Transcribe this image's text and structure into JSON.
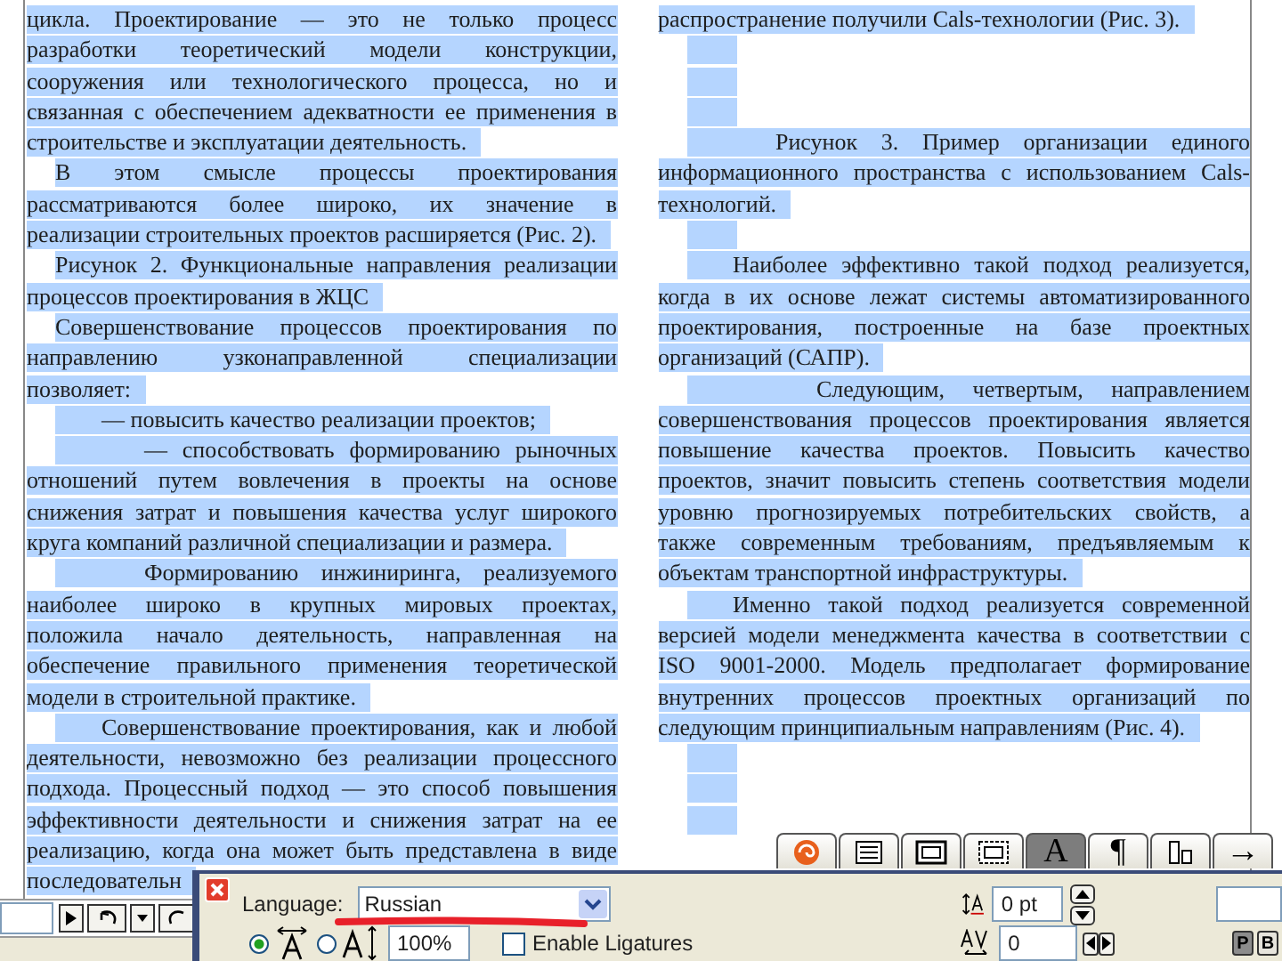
{
  "document": {
    "text_selected": true,
    "columns": [
      {
        "paragraphs": [
          {
            "kind": "continued",
            "lines": [
              "цикла. Проектирование — это не только процесс",
              "разработки теоретический модели конструкции,",
              "сооружения или технологического процесса, но и",
              "связанная с обеспечением адекватности ее применения в",
              "строительстве и эксплуатации деятельность."
            ]
          },
          {
            "kind": "tab1",
            "lines": [
              "В этом смысле процессы проектирования",
              "рассматриваются более широко, их значение в",
              "реализации строительных проектов расширяется (Рис. 2)."
            ]
          },
          {
            "kind": "tab1",
            "lines": [
              "Рисунок 2. Функциональные направления реализации",
              "процессов проектирования в ЖЦС"
            ]
          },
          {
            "kind": "tab1",
            "lines": [
              "Совершенствование процессов проектирования по",
              "направлению узконаправленной специализации",
              "позволяет:"
            ]
          },
          {
            "kind": "tab2",
            "lines": [
              "— повысить качество реализации проектов;"
            ]
          },
          {
            "kind": "tab3",
            "lines": [
              "— способствовать формированию рыночных",
              "отношений путем вовлечения в проекты  на основе",
              "снижения затрат и повышения качества услуг широкого",
              "круга компаний различной специализации и размера."
            ]
          },
          {
            "kind": "tab3",
            "lines": [
              "Формированию инжиниринга, реализуемого",
              "наиболее широко в крупных мировых проектах,",
              "положила начало деятельность, направленная на",
              "обеспечение правильного применения теоретической",
              "модели  в строительной практике."
            ]
          },
          {
            "kind": "tab2",
            "lines": [
              "Совершенствование проектирования, как и любой",
              "деятельности, невозможно без реализации процессного",
              "подхода. Процессный подход — это способ повышения",
              "эффективности деятельности и снижения затрат на ее",
              "реализацию, когда она может быть представлена в виде",
              "последовательн"
            ]
          }
        ]
      },
      {
        "paragraphs": [
          {
            "kind": "continued",
            "lines": [
              "распространение получили Cals-технологии (Рис. 3)."
            ]
          },
          {
            "kind": "empty"
          },
          {
            "kind": "empty"
          },
          {
            "kind": "empty"
          },
          {
            "kind": "tab3",
            "lines": [
              "Рисунок 3. Пример организации единого",
              "информационного пространства с использованием Cals-",
              "технологий."
            ]
          },
          {
            "kind": "empty"
          },
          {
            "kind": "tab2",
            "lines": [
              "Наиболее эффективно такой подход реализуется,",
              "когда в их основе лежат системы автоматизированного",
              "проектирования, построенные на базе проектных",
              "организаций (САПР)."
            ]
          },
          {
            "kind": "tab4",
            "lines": [
              "Следующим, четвертым, направлением",
              "совершенствования процессов проектирования является",
              "повышение качества проектов. Повысить качество",
              "проектов, значит повысить степень соответствия модели",
              "уровню прогнозируемых потребительских свойств, а",
              "также современным требованиям, предъявляемым к",
              "объектам транспортной инфраструктуры."
            ]
          },
          {
            "kind": "tab2",
            "lines": [
              "Именно такой подход реализуется современной",
              "версией модели менеджмента качества в соответствии с",
              "ISO 9001-2000. Модель предполагает формирование",
              "внутренних процессов проектных организаций по",
              "следующим принципиальным направлениям (Рис. 4)."
            ]
          },
          {
            "kind": "empty"
          },
          {
            "kind": "empty"
          },
          {
            "kind": "empty"
          }
        ]
      }
    ]
  },
  "palette_tabs": [
    {
      "kind": "swirl",
      "selected": false
    },
    {
      "kind": "lines",
      "selected": false
    },
    {
      "kind": "frame",
      "selected": false
    },
    {
      "kind": "dotted_frame",
      "selected": false
    },
    {
      "kind": "glyph",
      "label": "A",
      "selected": true
    },
    {
      "kind": "glyph",
      "label": "¶",
      "selected": false
    },
    {
      "kind": "columns",
      "selected": false
    },
    {
      "kind": "glyph",
      "label": "→",
      "selected": false
    }
  ],
  "palette": {
    "language_label": "Language:",
    "language": "Russian",
    "scaling": [
      {
        "kind": "horizontal",
        "selected": true
      },
      {
        "kind": "vertical",
        "selected": false
      }
    ],
    "scale_value": "100%",
    "ligatures": {
      "label": "Enable Ligatures",
      "checked": false
    },
    "baseline_shift": "0 pt",
    "kerning": "0",
    "mode_buttons": [
      {
        "label": "P",
        "selected": true
      },
      {
        "label": "B",
        "selected": false
      }
    ]
  }
}
